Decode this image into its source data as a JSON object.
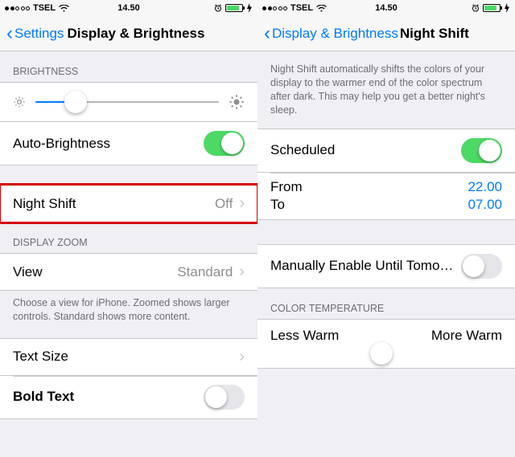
{
  "status": {
    "carrier": "TSEL",
    "time": "14.50"
  },
  "left": {
    "back": "Settings",
    "title": "Display & Brightness",
    "brightness_header": "BRIGHTNESS",
    "auto_brightness": "Auto-Brightness",
    "night_shift": {
      "label": "Night Shift",
      "value": "Off"
    },
    "display_zoom_header": "DISPLAY ZOOM",
    "view": {
      "label": "View",
      "value": "Standard"
    },
    "zoom_footer": "Choose a view for iPhone. Zoomed shows larger controls. Standard shows more content.",
    "text_size": "Text Size",
    "bold_text": "Bold Text"
  },
  "right": {
    "back": "Display & Brightness",
    "title": "Night Shift",
    "intro": "Night Shift automatically shifts the colors of your display to the warmer end of the color spectrum after dark. This may help you get a better night's sleep.",
    "scheduled": "Scheduled",
    "from_label": "From",
    "from_value": "22.00",
    "to_label": "To",
    "to_value": "07.00",
    "manual": "Manually Enable Until Tomorr...",
    "color_temp_header": "COLOR TEMPERATURE",
    "less_warm": "Less Warm",
    "more_warm": "More Warm"
  }
}
